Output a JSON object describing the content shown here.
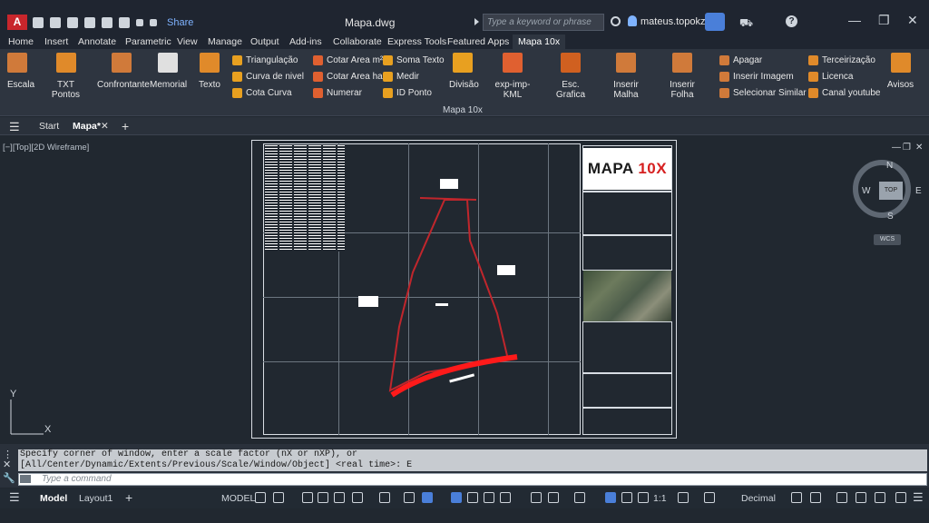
{
  "app": {
    "logo": "A",
    "doc_title": "Mapa.dwg",
    "share": "Share",
    "search_placeholder": "Type a keyword or phrase",
    "user": "mateus.topokz"
  },
  "menu": {
    "tabs": [
      "Home",
      "Insert",
      "Annotate",
      "Parametric",
      "View",
      "Manage",
      "Output",
      "Add-ins",
      "Collaborate",
      "Express Tools",
      "Featured Apps",
      "Mapa 10x"
    ]
  },
  "ribbon": {
    "large": [
      "Escala",
      "TXT Pontos",
      "Confrontante",
      "Memorial",
      "Texto",
      "Divisão",
      "exp-imp-KML",
      "Esc. Grafica",
      "Inserir Malha",
      "Inserir Folha",
      "Avisos"
    ],
    "col1": [
      "Triangulação",
      "Curva de nivel",
      "Cota Curva"
    ],
    "col2": [
      "Cotar Area m²",
      "Cotar Area ha",
      "Numerar"
    ],
    "col3": [
      "Soma Texto",
      "Medir",
      "ID Ponto"
    ],
    "col4": [
      "Apagar",
      "Inserir Imagem",
      "Selecionar Similar"
    ],
    "col5": [
      "Terceirização",
      "Licenca",
      "Canal youtube"
    ],
    "panel_label": "Mapa 10x",
    "txt_badge": "TXT"
  },
  "doctabs": {
    "start": "Start",
    "active": "Mapa*"
  },
  "viewport": {
    "label": "[−][Top][2D Wireframe]",
    "brand": "MAPA",
    "brand_x": "10X",
    "compass_n": "N",
    "compass_s": "S",
    "compass_e": "E",
    "compass_w": "W",
    "compass_top": "TOP",
    "wcs": "WCS",
    "axis_y": "Y",
    "axis_x": "X"
  },
  "command": {
    "line1": "Specify corner of window, enter a scale factor (nX or nXP), or",
    "line2": "[All/Center/Dynamic/Extents/Previous/Scale/Window/Object] <real time>: E",
    "placeholder": "Type a command"
  },
  "status": {
    "model_tab": "Model",
    "layout_tab": "Layout1",
    "model": "MODEL",
    "scale": "1:1",
    "units": "Decimal"
  }
}
